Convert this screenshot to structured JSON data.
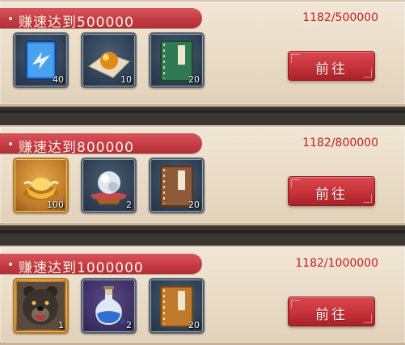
{
  "tasks": [
    {
      "title": "赚速达到500000",
      "progress": "1182/500000",
      "button_label": "前往",
      "rewards": [
        {
          "icon": "blue-speed-token-icon",
          "count": "40"
        },
        {
          "icon": "golden-pearl-icon",
          "count": "10"
        },
        {
          "icon": "green-book-icon",
          "count": "20"
        }
      ]
    },
    {
      "title": "赚速达到800000",
      "progress": "1182/800000",
      "button_label": "前往",
      "rewards": [
        {
          "icon": "gold-ingot-icon",
          "count": "100"
        },
        {
          "icon": "crystal-ball-icon",
          "count": "2"
        },
        {
          "icon": "brown-book-icon",
          "count": "20"
        }
      ]
    },
    {
      "title": "赚速达到1000000",
      "progress": "1182/1000000",
      "button_label": "前往",
      "rewards": [
        {
          "icon": "bear-portrait-icon",
          "count": "1"
        },
        {
          "icon": "blue-potion-icon",
          "count": "2"
        },
        {
          "icon": "orange-book-icon",
          "count": "20"
        }
      ]
    }
  ],
  "colors": {
    "banner": "#c63c44",
    "progress_text": "#c41d22",
    "button": "#c5323a",
    "panel": "#ebdecb"
  }
}
